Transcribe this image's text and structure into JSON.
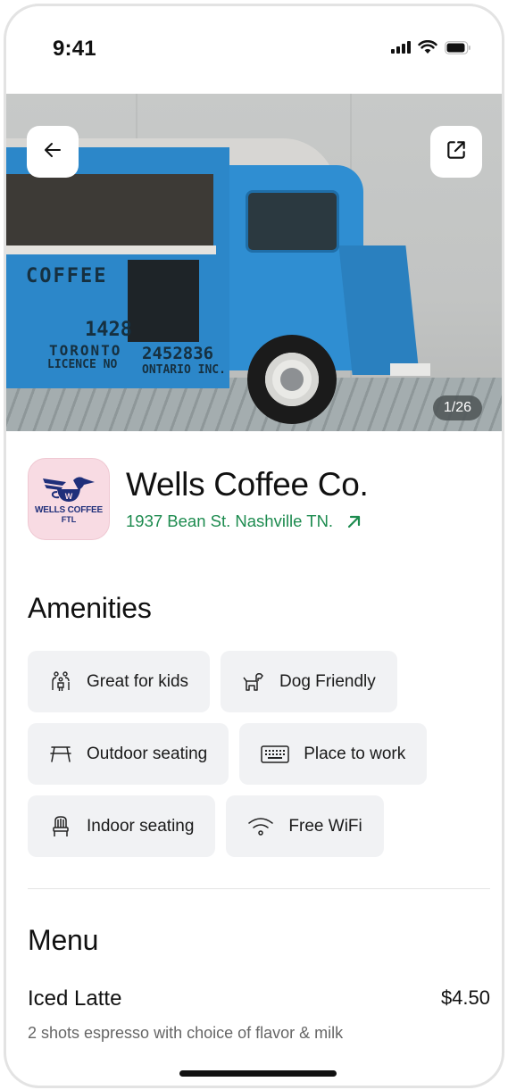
{
  "status_bar": {
    "time": "9:41",
    "icons": [
      "cellular-signal-icon",
      "wifi-icon",
      "battery-icon"
    ]
  },
  "hero": {
    "photo_description": "Blue vintage coffee truck",
    "photo_counter": "1/26",
    "back_button_icon": "arrow-left-icon",
    "share_button_icon": "share-external-icon",
    "truck_texts": {
      "side": "COFFEE",
      "licence_number": "1428",
      "licence_city": "TORONTO",
      "licence_label": "LICENCE NO",
      "company_number": "2452836",
      "company_name": "ONTARIO INC."
    }
  },
  "place": {
    "logo": {
      "brand": "WELLS COFFEE",
      "sub": "FTL",
      "mark": "W"
    },
    "name": "Wells Coffee Co.",
    "address": "1937 Bean St. Nashville TN.",
    "address_icon": "arrow-up-right-icon"
  },
  "colors": {
    "accent_green": "#1d8b4f",
    "chip_bg": "#f1f2f4",
    "logo_bg": "#f8dbe3",
    "logo_ink": "#1f2f7a"
  },
  "amenities": {
    "title": "Amenities",
    "items": [
      {
        "label": "Great for kids",
        "icon": "family-icon"
      },
      {
        "label": "Dog Friendly",
        "icon": "dog-icon"
      },
      {
        "label": "Outdoor seating",
        "icon": "picnic-table-icon"
      },
      {
        "label": "Place to work",
        "icon": "keyboard-icon"
      },
      {
        "label": "Indoor seating",
        "icon": "chair-icon"
      },
      {
        "label": "Free WiFi",
        "icon": "wifi-icon"
      }
    ]
  },
  "menu": {
    "title": "Menu",
    "items": [
      {
        "name": "Iced Latte",
        "price": "$4.50",
        "description": "2 shots espresso with choice of flavor & milk"
      }
    ]
  }
}
